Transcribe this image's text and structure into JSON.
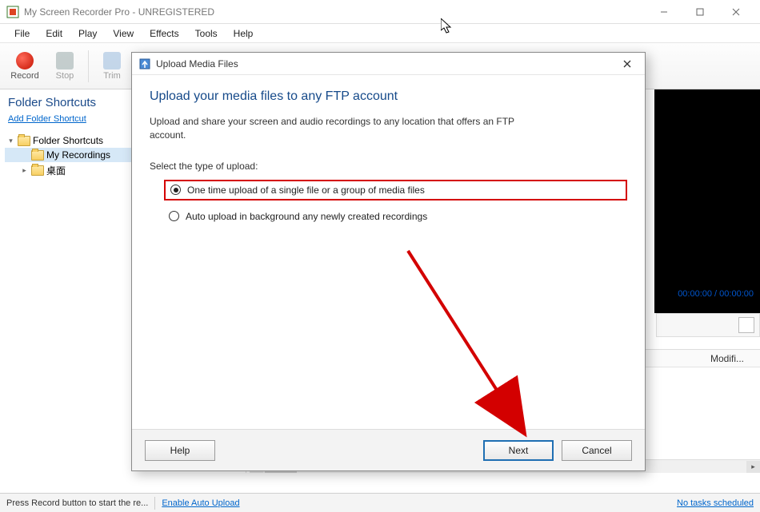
{
  "window": {
    "title": "My Screen Recorder Pro - UNREGISTERED"
  },
  "menu": {
    "items": [
      "File",
      "Edit",
      "Play",
      "View",
      "Effects",
      "Tools",
      "Help"
    ]
  },
  "toolbar": {
    "record": "Record",
    "stop": "Stop",
    "trim": "Trim"
  },
  "sidebar": {
    "heading": "Folder Shortcuts",
    "add_link": "Add Folder Shortcut",
    "nodes": {
      "root": "Folder Shortcuts",
      "my_rec": "My Recordings",
      "desktop": "桌面"
    }
  },
  "video": {
    "time": "00:00:00 / 00:00:00"
  },
  "filelist": {
    "col_modified": "Modifi..."
  },
  "status": {
    "hint": "Press Record button to start the re...",
    "auto_upload": "Enable Auto Upload",
    "tasks": "No tasks scheduled"
  },
  "dialog": {
    "title": "Upload Media Files",
    "heading": "Upload your media files to any FTP account",
    "desc": "Upload and share your screen and audio recordings to any location that offers an FTP account.",
    "select_label": "Select the type of upload:",
    "opt_once": "One time upload of a single file or a group of media files",
    "opt_auto": "Auto upload in background any newly created recordings",
    "help": "Help",
    "next": "Next",
    "cancel": "Cancel"
  }
}
